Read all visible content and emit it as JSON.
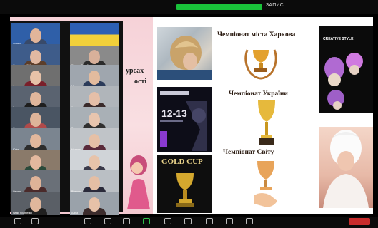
{
  "top_bar": {
    "recording_label": "",
    "meeting_label": "ЗАПИС"
  },
  "slide": {
    "left_text_1": "урсах",
    "left_text_2": "ості",
    "championships": [
      {
        "label": "Чемпіонат міста Харкова"
      },
      {
        "label": "Чемпіонат України"
      },
      {
        "label": "Чемпіонат Світу"
      }
    ],
    "images": {
      "hair": "hairstyle-photo",
      "poster_dates": "12-13",
      "goldcup_title": "GOLD CUP",
      "style_title": "CREATIVE STYLE",
      "portrait": "portrait-photo"
    }
  },
  "gallery": {
    "participants": [
      {
        "name": "Дмитро"
      },
      {
        "name": ""
      },
      {
        "name": "Олександр ДРС"
      },
      {
        "name": "Вікторія Тарабан"
      },
      {
        "name": "Анна"
      },
      {
        "name": "Марина"
      },
      {
        "name": "Ірина"
      },
      {
        "name": "Катерина"
      },
      {
        "name": "Олена"
      },
      {
        "name": "Тетяна"
      },
      {
        "name": "Юлія"
      },
      {
        "name": "Наталія"
      },
      {
        "name": "Людмила"
      },
      {
        "name": "Софія"
      },
      {
        "name": "Оксана"
      },
      {
        "name": "Вікторія"
      },
      {
        "name": "Надія Кравченко"
      },
      {
        "name": "Аліна"
      }
    ]
  },
  "colors": {
    "recording": "#19c23a",
    "end_button": "#c72c2c",
    "slide_pink": "#f6d2d8"
  },
  "icons": [
    "mic-icon",
    "video-icon",
    "security-icon",
    "participants-icon",
    "chat-icon",
    "share-screen-icon",
    "record-icon",
    "reactions-icon",
    "apps-icon",
    "whiteboard-icon",
    "more-icon"
  ]
}
